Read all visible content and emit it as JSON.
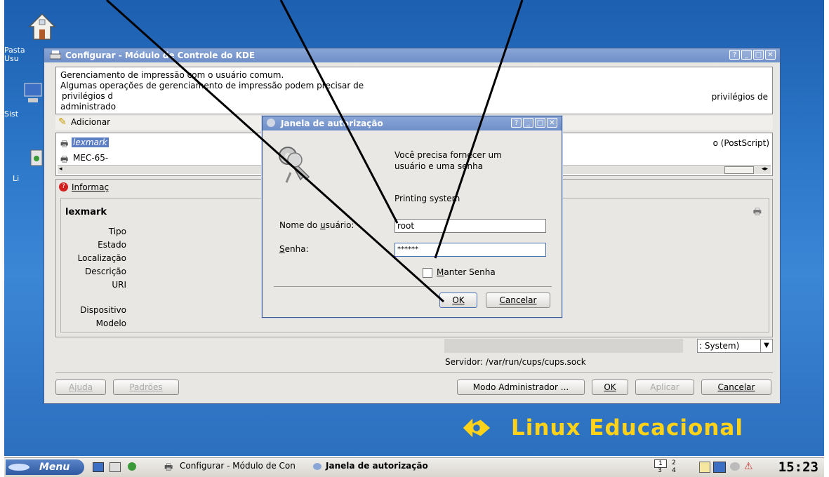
{
  "desktop": {
    "icons": [
      {
        "label": "Pasta\nUsu",
        "icon": "home-folder-icon"
      },
      {
        "label": "Sist",
        "icon": "computer-icon"
      },
      {
        "label": "Li",
        "icon": "trash-icon"
      }
    ],
    "brand": "Linux Educacional"
  },
  "main_window": {
    "title": "Configurar - Módulo de Controle do KDE",
    "info_lines": [
      "Gerenciamento de impressão com o usuário comum.",
      "Algumas operações de gerenciamento de impressão podem precisar de",
      "privilégios d",
      "administrado"
    ],
    "info_right": "privilégios de",
    "toolbar_item": "Adicionar",
    "printers": [
      {
        "name": "lexmark",
        "right": "o (PostScript)"
      },
      {
        "name": "MEC-65-"
      }
    ],
    "info_tab": "Informaç",
    "printer_heading": "lexmark",
    "properties": [
      "Tipo",
      "Estado",
      "Localização",
      "Descrição",
      "URI",
      "Dispositivo",
      "Modelo"
    ],
    "system_combo": ": System)",
    "server_text": "Servidor: /var/run/cups/cups.sock",
    "buttons": {
      "help": "Ajuda",
      "defaults": "Padrões",
      "admin_mode": "Modo Administrador ...",
      "ok": "OK",
      "apply": "Aplicar",
      "cancel": "Cancelar"
    }
  },
  "auth_dialog": {
    "title": "Janela de autorização",
    "message_line1": "Você precisa fornecer um",
    "message_line2": "usuário e uma senha",
    "subtitle": "Printing system",
    "username_label": "Nome do usuário:",
    "username_value": "root",
    "password_label": "Senha:",
    "password_value": "******",
    "keep_password_label": "Manter Senha",
    "keep_password_checked": false,
    "ok_label": "OK",
    "cancel_label": "Cancelar"
  },
  "taskbar": {
    "menu_label": "Menu",
    "tasks": [
      "Configurar - Módulo de Con",
      "Janela de autorização"
    ],
    "pager": [
      "1",
      "2",
      "3",
      "4"
    ],
    "clock": "15:23"
  },
  "colors": {
    "desktop_blue": "#2d78c9",
    "titlebar_blue": "#7f9ad0",
    "brand_yellow": "#ffd21a",
    "selection_blue": "#5b7ec4",
    "annotation_line": "#000000"
  }
}
